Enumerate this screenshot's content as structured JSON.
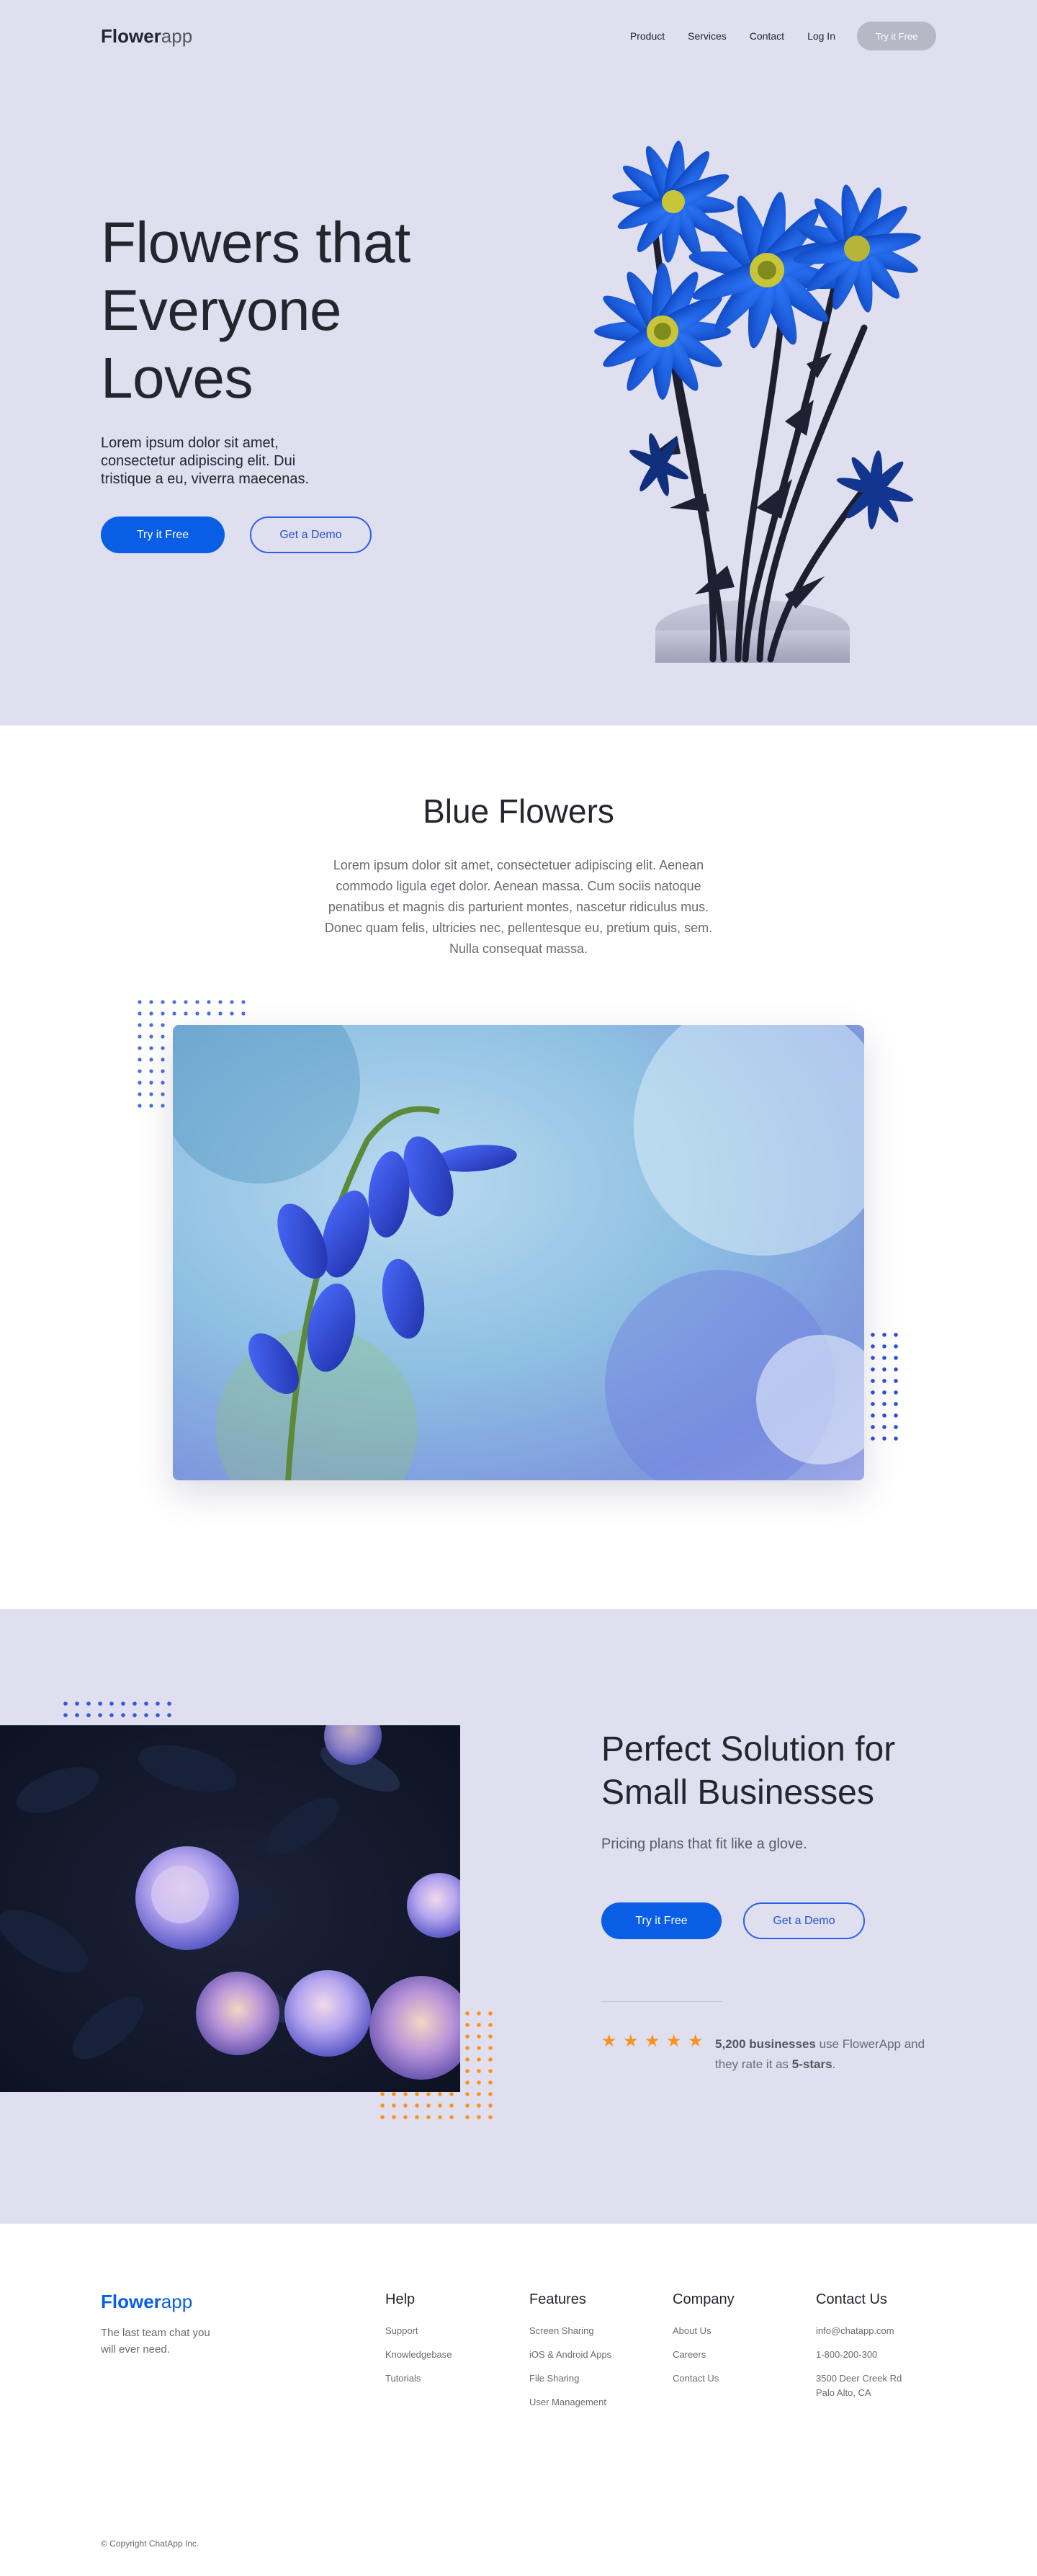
{
  "nav": {
    "logo_bold": "Flower",
    "logo_light": "app",
    "links": [
      "Product",
      "Services",
      "Contact",
      "Log In"
    ],
    "cta": "Try it Free"
  },
  "hero": {
    "title": "Flowers that Everyone Loves",
    "subtitle": "Lorem ipsum dolor sit amet, consectetur adipiscing elit. Dui tristique a eu, viverra maecenas.",
    "primary_button": "Try it Free",
    "secondary_button": "Get a Demo"
  },
  "blue_flowers": {
    "title": "Blue Flowers",
    "text": "Lorem ipsum dolor sit amet, consectetuer adipiscing elit. Aenean commodo ligula eget dolor. Aenean massa. Cum sociis natoque penatibus et magnis dis parturient montes, nascetur ridiculus mus. Donec quam felis, ultricies nec, pellentesque eu, pretium quis, sem. Nulla consequat massa."
  },
  "business": {
    "title": "Perfect Solution for Small Businesses",
    "subtitle": "Pricing plans that fit like a glove.",
    "primary_button": "Try it Free",
    "secondary_button": "Get a Demo",
    "stars": 5,
    "rating_count": "5,200 businesses",
    "rating_mid": " use FlowerApp and they rate it as ",
    "rating_value": "5-stars",
    "rating_end": "."
  },
  "footer": {
    "logo_bold": "Flower",
    "logo_light": "app",
    "tagline": "The last team chat you will ever need.",
    "columns": [
      {
        "title": "Help",
        "items": [
          "Support",
          "Knowledgebase",
          "Tutorials"
        ]
      },
      {
        "title": "Features",
        "items": [
          "Screen Sharing",
          "iOS & Android Apps",
          "File Sharing",
          "User Management"
        ]
      },
      {
        "title": "Company",
        "items": [
          "About Us",
          "Careers",
          "Contact Us"
        ]
      },
      {
        "title": "Contact Us",
        "items": [
          "info@chatapp.com",
          "1-800-200-300",
          "3500 Deer Creek Rd Palo Alto, CA"
        ]
      }
    ],
    "copyright": "© Copyright ChatApp Inc."
  },
  "colors": {
    "bg_lavender": "#dfdfef",
    "primary": "#0a5ee6",
    "accent_orange": "#f7931e",
    "text_dark": "#25252f",
    "text_muted": "#6a6a73"
  },
  "icons": {
    "star": "star-icon"
  }
}
